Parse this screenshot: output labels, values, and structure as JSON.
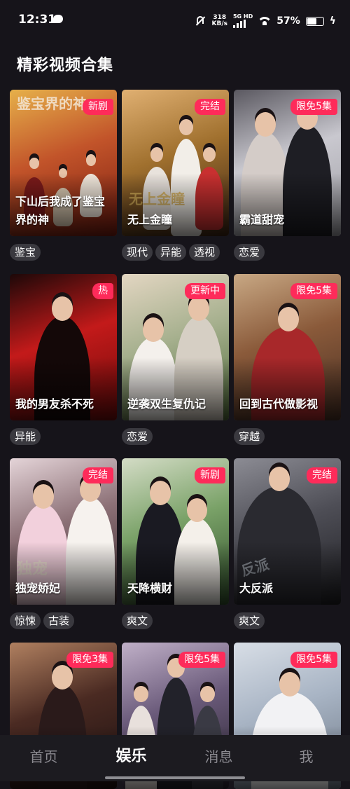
{
  "status_bar": {
    "time": "12:31",
    "net_speed_value": "318",
    "net_speed_unit": "KB/s",
    "network": "5G HD",
    "battery": "57%"
  },
  "page": {
    "title": "精彩视频合集"
  },
  "cards": [
    {
      "title": "下山后我成了鉴宝界的神",
      "badge": "新剧",
      "tags": [
        "鉴宝"
      ],
      "art": "鉴宝界的神"
    },
    {
      "title": "无上金瞳",
      "badge": "完结",
      "tags": [
        "现代",
        "异能",
        "透视"
      ],
      "art": "无上金瞳"
    },
    {
      "title": "霸道甜宠",
      "badge": "限免5集",
      "tags": [
        "恋爱"
      ],
      "art": ""
    },
    {
      "title": "我的男友杀不死",
      "badge": "热",
      "tags": [
        "异能"
      ],
      "art": ""
    },
    {
      "title": "逆袭双生复仇记",
      "badge": "更新中",
      "tags": [
        "恋爱"
      ],
      "art": ""
    },
    {
      "title": "回到古代做影视",
      "badge": "限免5集",
      "tags": [
        "穿越"
      ],
      "art": ""
    },
    {
      "title": "独宠娇妃",
      "badge": "完结",
      "tags": [
        "惊悚",
        "古装"
      ],
      "art": "独宠"
    },
    {
      "title": "天降横财",
      "badge": "新剧",
      "tags": [
        "爽文"
      ],
      "art": ""
    },
    {
      "title": "大反派",
      "badge": "完结",
      "tags": [
        "爽文"
      ],
      "art": "反派"
    },
    {
      "title": "",
      "badge": "限免3集",
      "tags": [],
      "art": ""
    },
    {
      "title": "",
      "badge": "限免5集",
      "tags": [],
      "art": ""
    },
    {
      "title": "",
      "badge": "限免5集",
      "tags": [],
      "art": ""
    }
  ],
  "bottom_nav": [
    {
      "label": "首页",
      "active": false
    },
    {
      "label": "娱乐",
      "active": true
    },
    {
      "label": "消息",
      "active": false
    },
    {
      "label": "我",
      "active": false
    }
  ],
  "colors": {
    "background": "#16141a",
    "badge": "#fe2b5a",
    "tag_bg": "#3a393f",
    "nav_bg": "#1c1b20",
    "nav_inactive": "#8b8a90"
  },
  "icons": [
    "chat-bubble-icon",
    "mute-icon",
    "signal-icon",
    "wifi-icon",
    "battery-icon",
    "charging-icon"
  ]
}
